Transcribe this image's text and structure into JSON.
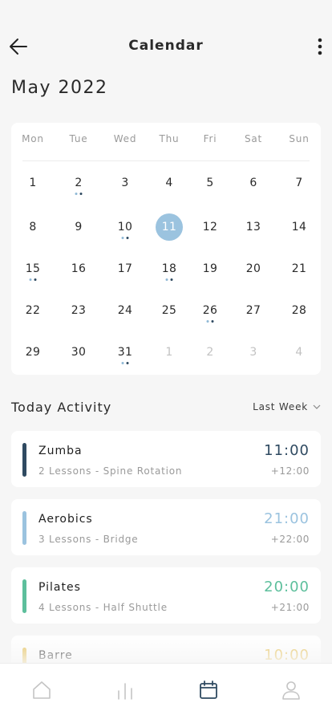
{
  "header": {
    "title": "Calendar"
  },
  "month_label": "May 2022",
  "weekdays": [
    "Mon",
    "Tue",
    "Wed",
    "Thu",
    "Fri",
    "Sat",
    "Sun"
  ],
  "days": [
    [
      "1",
      "2",
      "3",
      "4",
      "5",
      "6",
      "7"
    ],
    [
      "8",
      "9",
      "10",
      "11",
      "12",
      "13",
      "14"
    ],
    [
      "15",
      "16",
      "17",
      "18",
      "19",
      "20",
      "21"
    ],
    [
      "22",
      "23",
      "24",
      "25",
      "26",
      "27",
      "28"
    ],
    [
      "29",
      "30",
      "31",
      "1",
      "2",
      "3",
      "4"
    ]
  ],
  "selected_day": "11",
  "event_days": [
    "2",
    "10",
    "15",
    "18",
    "26",
    "31"
  ],
  "activity": {
    "title": "Today Activity",
    "filter": "Last Week",
    "items": [
      {
        "name": "Zumba",
        "detail": "2 Lessons - Spine Rotation",
        "time": "11:00",
        "delta": "+12:00",
        "color": "#2f4a61"
      },
      {
        "name": "Aerobics",
        "detail": "3 Lessons - Bridge",
        "time": "21:00",
        "delta": "+22:00",
        "color": "#9bc3df"
      },
      {
        "name": "Pilates",
        "detail": "4 Lessons - Half Shuttle",
        "time": "20:00",
        "delta": "+21:00",
        "color": "#5dbf9c"
      },
      {
        "name": "Barre",
        "detail": "",
        "time": "10:00",
        "delta": "",
        "color": "#e8c35a"
      }
    ]
  },
  "tabs": [
    "home-icon",
    "stats-icon",
    "calendar-icon",
    "profile-icon"
  ],
  "colors": {
    "accent": "#9bc3df",
    "active_tab": "#2f4a61",
    "inactive_tab": "#c4c4c4"
  }
}
